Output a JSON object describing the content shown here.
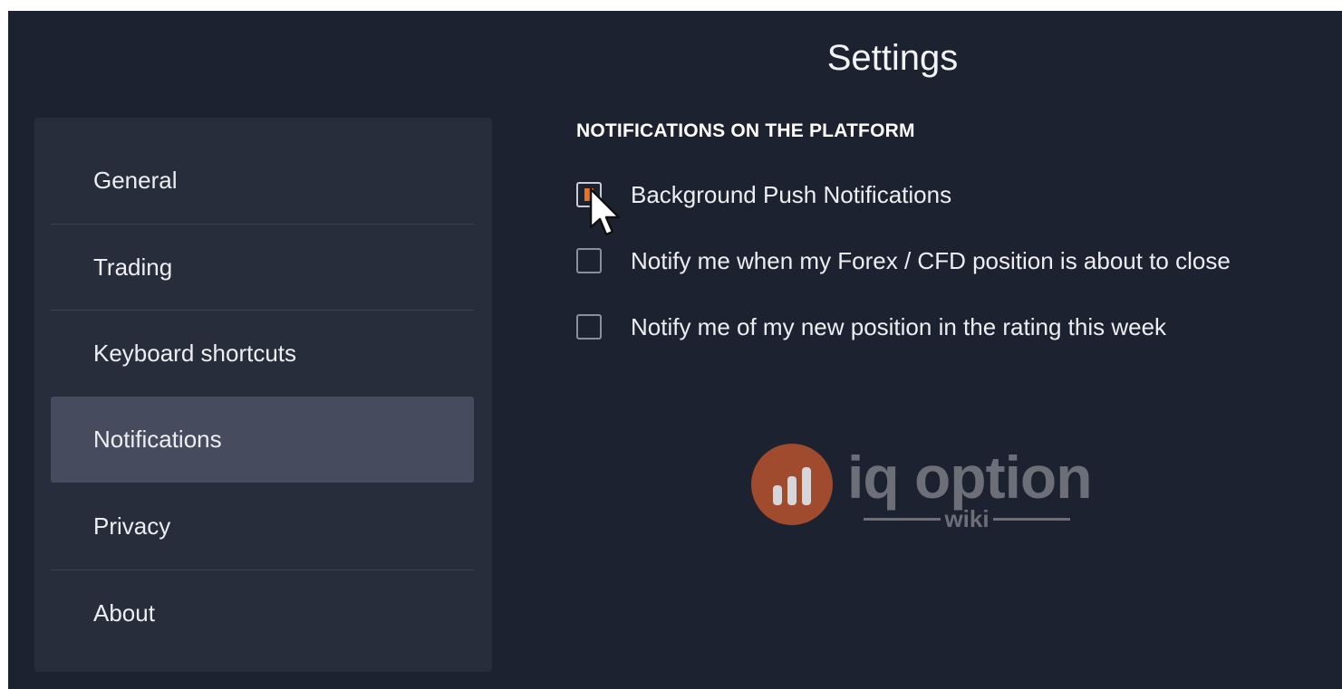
{
  "page": {
    "title": "Settings"
  },
  "sidebar": {
    "items": [
      {
        "label": "General",
        "active": false
      },
      {
        "label": "Trading",
        "active": false
      },
      {
        "label": "Keyboard shortcuts",
        "active": false
      },
      {
        "label": "Notifications",
        "active": true
      },
      {
        "label": "Privacy",
        "active": false
      },
      {
        "label": "About",
        "active": false
      }
    ]
  },
  "notifications": {
    "section_heading": "NOTIFICATIONS ON THE PLATFORM",
    "options": [
      {
        "label": "Background Push Notifications",
        "checked": true
      },
      {
        "label": "Notify me when my Forex / CFD position is about to close",
        "checked": false
      },
      {
        "label": "Notify me of my new position in the rating this week",
        "checked": false
      }
    ]
  },
  "watermark": {
    "brand": "iq option",
    "sub": "wiki"
  },
  "colors": {
    "background": "#1d2230",
    "sidebar": "#282d3c",
    "active_item": "#464c5d",
    "checkbox_fill": "#e8761c",
    "watermark_circle": "#a04a2e"
  },
  "icons": {
    "cursor": "mouse-pointer-icon",
    "logo": "bar-chart-logo-icon"
  }
}
